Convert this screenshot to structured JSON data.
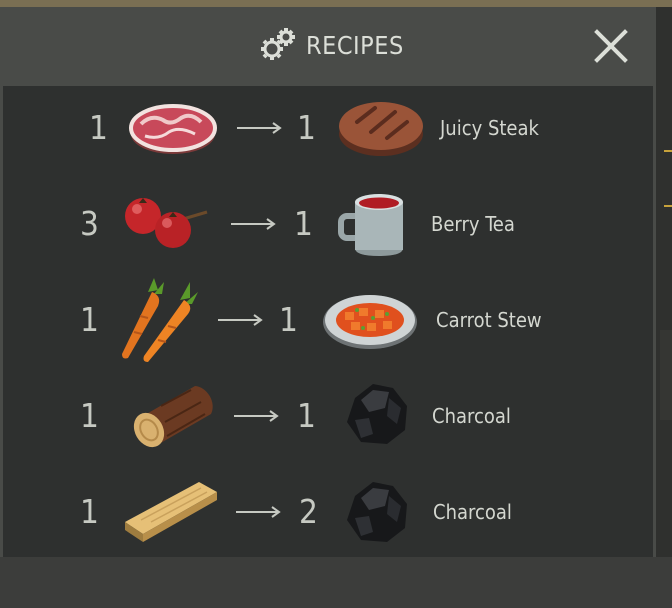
{
  "header": {
    "title": "RECIPES",
    "icon": "gears-icon",
    "close_icon": "close-icon"
  },
  "colors": {
    "panel": "#494b48",
    "list": "#2e302f",
    "text": "#d4d7d0",
    "accent": "#c7a23b"
  },
  "recipes": [
    {
      "input_qty": "1",
      "input_icon": "raw-meat-icon",
      "output_qty": "1",
      "output_icon": "steak-icon",
      "name": "Juicy Steak"
    },
    {
      "input_qty": "3",
      "input_icon": "berries-icon",
      "output_qty": "1",
      "output_icon": "tea-cup-icon",
      "name": "Berry Tea"
    },
    {
      "input_qty": "1",
      "input_icon": "carrots-icon",
      "output_qty": "1",
      "output_icon": "stew-plate-icon",
      "name": "Carrot Stew"
    },
    {
      "input_qty": "1",
      "input_icon": "log-icon",
      "output_qty": "1",
      "output_icon": "charcoal-icon",
      "name": "Charcoal"
    },
    {
      "input_qty": "1",
      "input_icon": "plank-icon",
      "output_qty": "2",
      "output_icon": "charcoal-icon",
      "name": "Charcoal"
    }
  ]
}
